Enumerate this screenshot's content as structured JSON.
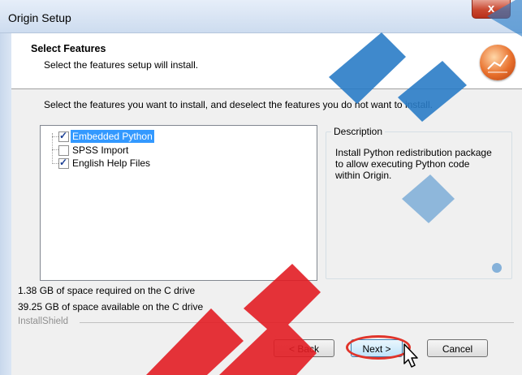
{
  "window": {
    "title": "Origin Setup",
    "close_glyph": "x"
  },
  "header": {
    "title": "Select Features",
    "subtitle": "Select the features setup will install."
  },
  "instruction": "Select the features you want to install, and deselect the features you do not want to install.",
  "features": [
    {
      "label": "Embedded Python",
      "checked": true,
      "selected": true
    },
    {
      "label": "SPSS Import",
      "checked": false,
      "selected": false
    },
    {
      "label": "English Help Files",
      "checked": true,
      "selected": false
    }
  ],
  "description": {
    "legend": "Description",
    "text": "Install Python redistribution package to allow executing Python code within Origin."
  },
  "space": {
    "required": "1.38 GB of space required on the C drive",
    "available": "39.25 GB of space available on the C drive"
  },
  "brand": "InstallShield",
  "buttons": {
    "back": "< Back",
    "next": "Next >",
    "cancel": "Cancel"
  },
  "icons": {
    "logo": "origin-logo-icon",
    "cursor": "mouse-pointer-icon"
  }
}
